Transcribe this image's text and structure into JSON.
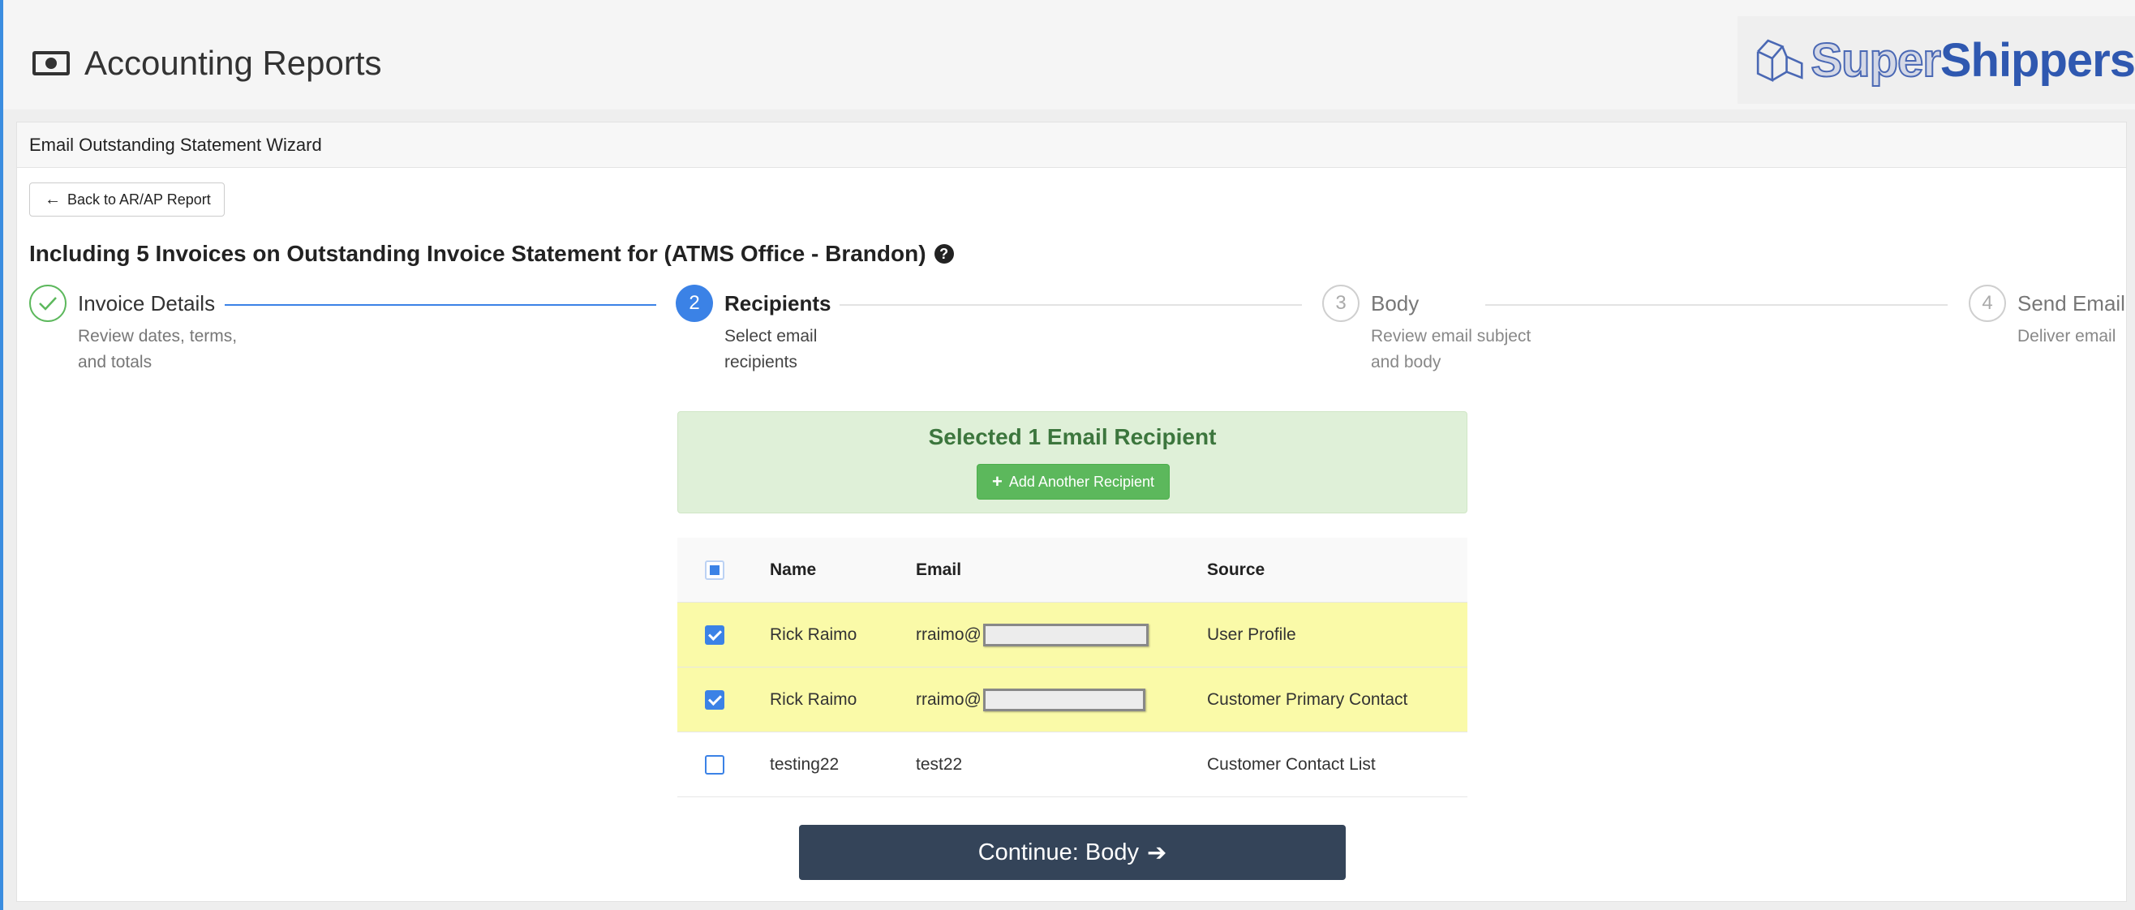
{
  "header": {
    "title": "Accounting Reports",
    "logo_part1": "Super",
    "logo_part2": "Shippers"
  },
  "panel": {
    "heading": "Email Outstanding Statement Wizard",
    "back_label": "Back to AR/AP Report",
    "statement_title": "Including 5 Invoices on Outstanding Invoice Statement for (ATMS Office - Brandon)"
  },
  "steps": [
    {
      "number": "1",
      "title": "Invoice Details",
      "sub1": "Review dates, terms,",
      "sub2": "and totals",
      "state": "complete"
    },
    {
      "number": "2",
      "title": "Recipients",
      "sub1": "Select email",
      "sub2": "recipients",
      "state": "active"
    },
    {
      "number": "3",
      "title": "Body",
      "sub1": "Review email subject",
      "sub2": "and body",
      "state": "pending"
    },
    {
      "number": "4",
      "title": "Send Email",
      "sub1": "Deliver email",
      "sub2": "",
      "state": "pending"
    }
  ],
  "alert": {
    "title": "Selected 1 Email Recipient",
    "add_label": "Add Another Recipient"
  },
  "table": {
    "columns": [
      "Name",
      "Email",
      "Source"
    ],
    "rows": [
      {
        "name": "Rick Raimo",
        "email": "rraimo@",
        "source": "User Profile",
        "checked": true
      },
      {
        "name": "Rick Raimo",
        "email": "rraimo@",
        "source": "Customer Primary Contact",
        "checked": true
      },
      {
        "name": "testing22",
        "email": "test22",
        "source": "Customer Contact List",
        "checked": false
      }
    ]
  },
  "continue_label": "Continue: Body",
  "colors": {
    "primary": "#3b82e6",
    "success": "#5cb85c",
    "alert_bg": "#dff0d8",
    "highlight_row": "#fafaa8",
    "dark_button": "#344459"
  }
}
